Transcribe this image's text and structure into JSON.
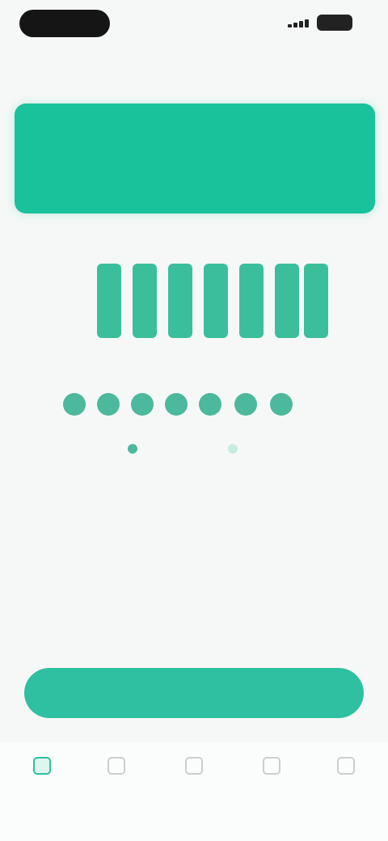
{
  "header": {
    "title": ""
  },
  "banner": {
    "title": "",
    "subtitle": ""
  },
  "chart": {
    "caption": "",
    "y_ticks": [
      "",
      "",
      "",
      ""
    ],
    "x_ticks": [
      "",
      "",
      "",
      "",
      "",
      "",
      ""
    ],
    "bar_labels": [
      "",
      "",
      "",
      "",
      "",
      "",
      ""
    ]
  },
  "legend": {
    "a": "",
    "b": ""
  },
  "table": {
    "rows": [
      [
        "",
        "",
        "",
        ""
      ],
      [
        "",
        "",
        "",
        ""
      ],
      [
        "",
        "",
        "",
        ""
      ],
      [
        "",
        "",
        "",
        ""
      ],
      [
        "",
        "",
        "",
        ""
      ],
      [
        "",
        "",
        "",
        ""
      ]
    ]
  },
  "cta": {
    "label": ""
  },
  "tabs": [
    {
      "label": "",
      "icon": "home-icon"
    },
    {
      "label": "",
      "icon": "list-icon"
    },
    {
      "label": "",
      "icon": "chart-icon"
    },
    {
      "label": "",
      "icon": "bell-icon"
    },
    {
      "label": "",
      "icon": "user-icon"
    }
  ],
  "colors": {
    "accent": "#19c29b",
    "bar": "#3bbf9b",
    "button": "#2ec0a0"
  }
}
